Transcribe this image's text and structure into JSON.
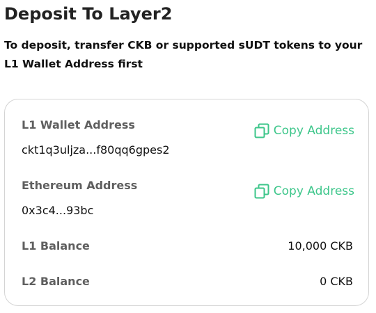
{
  "header": {
    "title": "Deposit To Layer2",
    "instruction": "To deposit, transfer CKB or supported sUDT tokens to your L1 Wallet Address first"
  },
  "details": {
    "l1_wallet": {
      "label": "L1 Wallet Address",
      "value": "ckt1q3uljza...f80qq6gpes2",
      "copy_label": "Copy Address"
    },
    "ethereum": {
      "label": "Ethereum Address",
      "value": "0x3c4...93bc",
      "copy_label": "Copy Address"
    },
    "l1_balance": {
      "label": "L1 Balance",
      "value": "10,000 CKB"
    },
    "l2_balance": {
      "label": "L2 Balance",
      "value": "0 CKB"
    }
  },
  "icons": {
    "copy": "copy-icon"
  },
  "colors": {
    "accent": "#3cc68a",
    "label": "#5f5f5f",
    "border": "#d4d4d4"
  }
}
